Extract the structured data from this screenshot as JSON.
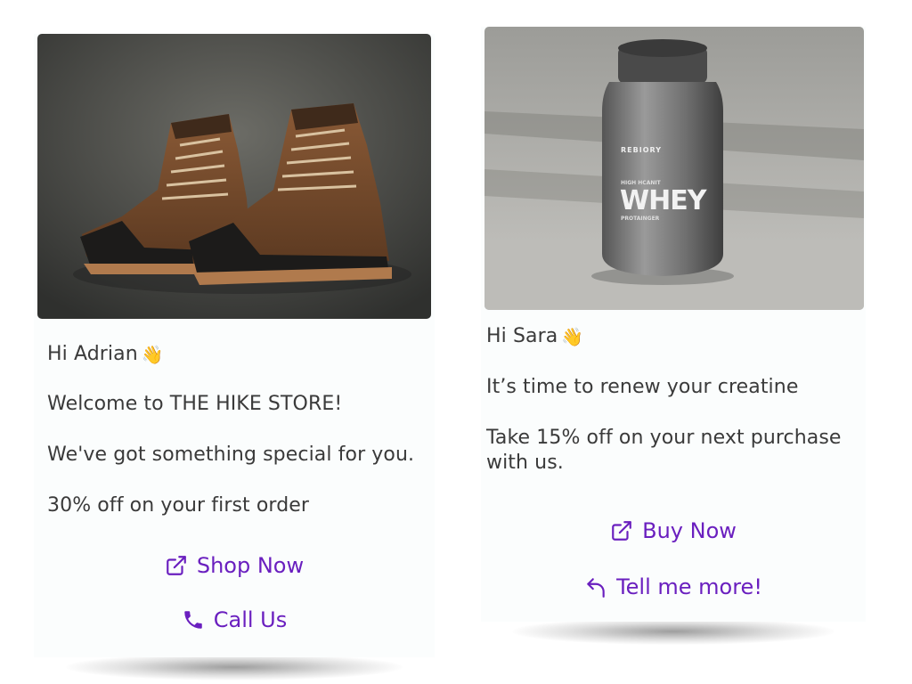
{
  "cards": [
    {
      "greeting": "Hi Adrian",
      "greeting_emoji": "👋",
      "lines": [
        "Welcome to THE HIKE STORE!",
        "We've got something special for you.",
        "30% off on your first order"
      ],
      "image": "hiking-boots-photo",
      "actions": [
        {
          "label": "Shop Now",
          "icon": "external-link-icon"
        },
        {
          "label": "Call Us",
          "icon": "phone-icon"
        }
      ]
    },
    {
      "greeting": "Hi Sara",
      "greeting_emoji": "👋",
      "lines": [
        "It’s time to renew your creatine",
        "Take 15% off on your next purchase with us."
      ],
      "image": "whey-protein-tub-photo",
      "product_brand": "REBIORY",
      "product_name": "WHEY",
      "product_sub_top": "HIGH HCANIT",
      "product_sub_bottom": "PROTAINGER",
      "actions": [
        {
          "label": "Buy Now",
          "icon": "external-link-icon"
        },
        {
          "label": "Tell me more!",
          "icon": "reply-arrow-icon"
        }
      ]
    }
  ],
  "colors": {
    "accent": "#6a1fbf",
    "text": "#3a3a3a",
    "card": "#fbfdfd"
  }
}
